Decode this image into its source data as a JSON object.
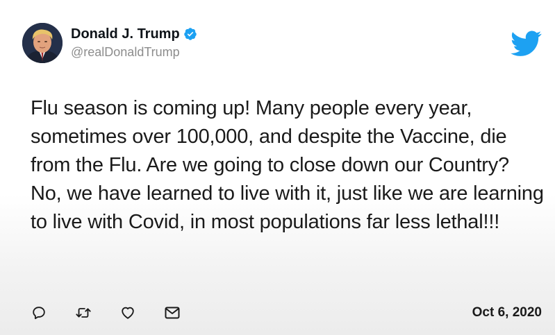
{
  "tweet": {
    "display_name": "Donald J. Trump",
    "handle": "@realDonaldTrump",
    "verified": true,
    "text": "Flu season is coming up! Many people every year, sometimes over 100,000, and despite the Vaccine, die from the Flu. Are we going to close down our Country? No, we have learned to live with it, just like we are learning to live with Covid, in most populations far less lethal!!!",
    "date": "Oct 6, 2020"
  },
  "icons": {
    "brand": "twitter-bird-icon",
    "verified": "verified-badge-icon",
    "actions": [
      "reply-icon",
      "retweet-icon",
      "like-icon",
      "share-icon"
    ]
  },
  "colors": {
    "brand": "#1da1f2",
    "text": "#0f1419",
    "handle": "#8c8c8c",
    "icon": "#1a1a1a"
  }
}
